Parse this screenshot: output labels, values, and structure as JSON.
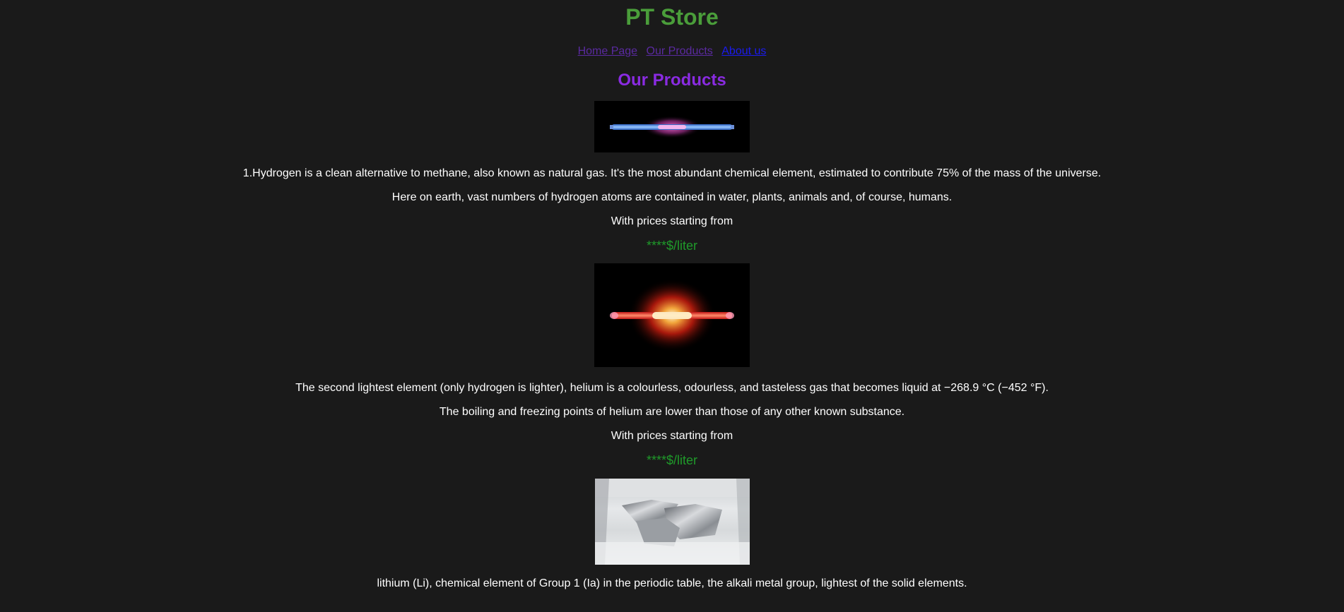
{
  "header": {
    "site_title": "PT Store"
  },
  "nav": {
    "items": [
      {
        "label": "Home Page",
        "state": "visited"
      },
      {
        "label": "Our Products",
        "state": "visited"
      },
      {
        "label": "About us",
        "state": "link"
      }
    ]
  },
  "main": {
    "section_title": "Our Products",
    "products": [
      {
        "image_icon": "hydrogen-discharge-tube-image",
        "lines": [
          "1.Hydrogen is a clean alternative to methane, also known as natural gas. It's the most abundant chemical element, estimated to contribute 75% of the mass of the universe.",
          "Here on earth, vast numbers of hydrogen atoms are contained in water, plants, animals and, of course, humans.",
          "With prices starting from"
        ],
        "price": "****$/liter"
      },
      {
        "image_icon": "helium-discharge-tube-image",
        "lines": [
          "The second lightest element (only hydrogen is lighter), helium is a colourless, odourless, and tasteless gas that becomes liquid at −268.9 °C (−452 °F).",
          "The boiling and freezing points of helium are lower than those of any other known substance.",
          "With prices starting from"
        ],
        "price": "****$/liter"
      },
      {
        "image_icon": "lithium-metal-image",
        "lines": [
          "lithium (Li), chemical element of Group 1 (Ia) in the periodic table, the alkali metal group, lightest of the solid elements."
        ]
      }
    ]
  },
  "colors": {
    "background": "#1a1a1a",
    "title_green": "#4a9d3a",
    "section_purple": "#8a2be2",
    "price_green": "#1f9a2a",
    "visited_link": "#5a2aa0",
    "link": "#1a1aee"
  }
}
